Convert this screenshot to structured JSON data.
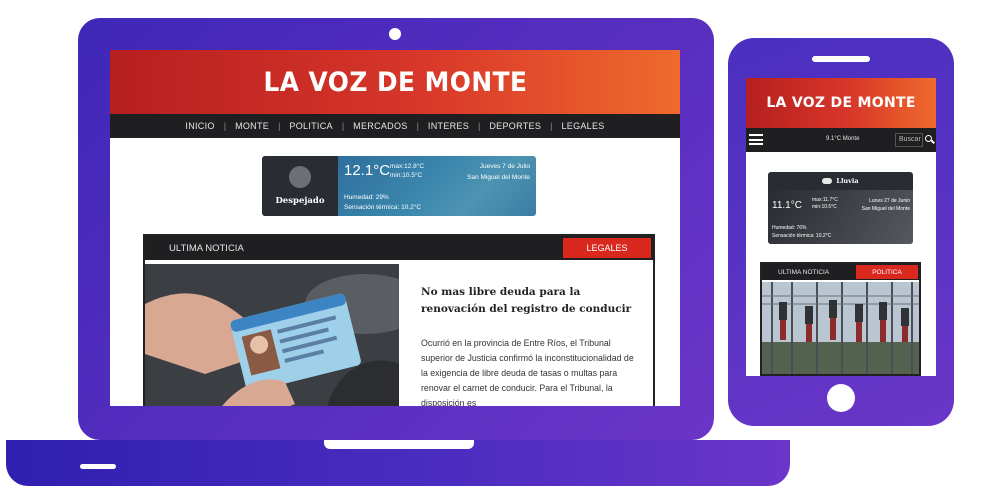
{
  "desktop": {
    "site_title": "LA VOZ DE MONTE",
    "nav": [
      "INICIO",
      "MONTE",
      "POLITICA",
      "MERCADOS",
      "INTERES",
      "DEPORTES",
      "LEGALES"
    ],
    "weather": {
      "condition": "Despejado",
      "temperature": "12.1°C",
      "max": "max:12.8°C",
      "min": "min:10.5°C",
      "date": "Jueves 7 de Julio",
      "location": "San Miguel del Monte",
      "humidity": "Humedad: 29%",
      "feels_like": "Sensación térmica: 10.2°C"
    },
    "news_card": {
      "label": "ULTIMA NOTICIA",
      "category": "LEGALES",
      "title": "No mas libre deuda para la renovación del registro de conducir",
      "body": "Ocurrió en la provincia de Entre Ríos, el Tribunal superior de Justicia confirmó la inconstitucionalidad de la exigencia de libre deuda de tasas o multas para renovar el carnet de conducir. Para el Tribunal, la disposición es"
    }
  },
  "mobile": {
    "site_title": "LA VOZ DE MONTE",
    "temp_location": "9.1°C Monte",
    "search_placeholder": "Buscar",
    "weather": {
      "condition": "Lluvia",
      "temperature": "11.1°C",
      "max": "max:11.7°C",
      "min": "min:10.5°C",
      "date": "Lunes 27 de Junio",
      "location": "San Miguel del Monte",
      "humidity": "Humedad: 76%",
      "feels_like": "Sensación térmica: 10.2°C"
    },
    "news_card": {
      "label": "ULTIMA NOTICIA",
      "category": "POLITICA"
    }
  },
  "colors": {
    "device_purple": "#4a2fc0",
    "brand_red": "#d9291f",
    "banner_orange": "#ef6a2c",
    "nav_dark": "#1f1f22"
  }
}
